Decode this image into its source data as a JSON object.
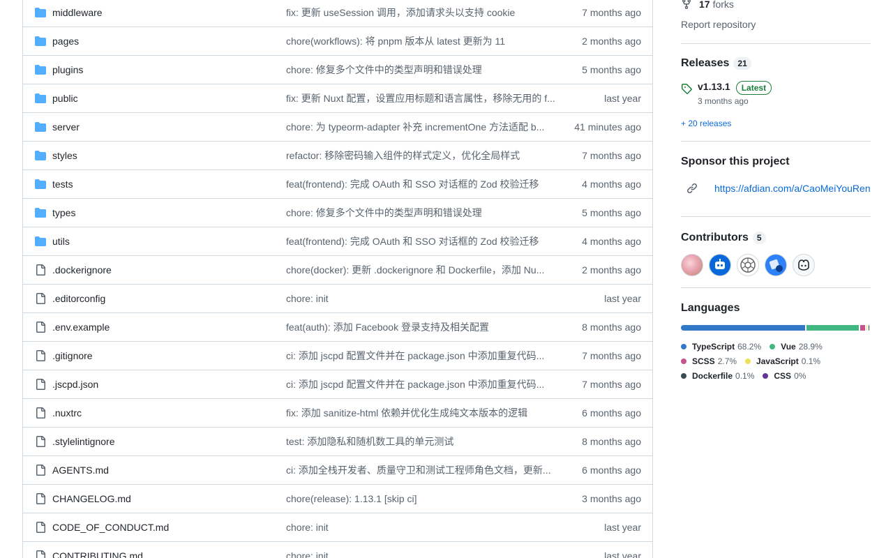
{
  "files": [
    {
      "type": "dir",
      "name": "middleware",
      "message": "fix: 更新 useSession 调用，添加请求头以支持 cookie",
      "date": "7 months ago"
    },
    {
      "type": "dir",
      "name": "pages",
      "message": "chore(workflows): 将 pnpm 版本从 latest 更新为 11",
      "date": "2 months ago"
    },
    {
      "type": "dir",
      "name": "plugins",
      "message": "chore: 修复多个文件中的类型声明和错误处理",
      "date": "5 months ago"
    },
    {
      "type": "dir",
      "name": "public",
      "message": "fix: 更新 Nuxt 配置，设置应用标题和语言属性，移除无用的 f...",
      "date": "last year"
    },
    {
      "type": "dir",
      "name": "server",
      "message": "chore: 为 typeorm-adapter 补充 incrementOne 方法适配 b...",
      "date": "41 minutes ago"
    },
    {
      "type": "dir",
      "name": "styles",
      "message": "refactor: 移除密码输入组件的样式定义，优化全局样式",
      "date": "7 months ago"
    },
    {
      "type": "dir",
      "name": "tests",
      "message": "feat(frontend): 完成 OAuth 和 SSO 对话框的 Zod 校验迁移",
      "date": "4 months ago"
    },
    {
      "type": "dir",
      "name": "types",
      "message": "chore: 修复多个文件中的类型声明和错误处理",
      "date": "5 months ago"
    },
    {
      "type": "dir",
      "name": "utils",
      "message": "feat(frontend): 完成 OAuth 和 SSO 对话框的 Zod 校验迁移",
      "date": "4 months ago"
    },
    {
      "type": "file",
      "name": ".dockerignore",
      "message": "chore(docker): 更新 .dockerignore 和 Dockerfile，添加 Nu...",
      "date": "2 months ago"
    },
    {
      "type": "file",
      "name": ".editorconfig",
      "message": "chore: init",
      "date": "last year"
    },
    {
      "type": "file",
      "name": ".env.example",
      "message": "feat(auth): 添加 Facebook 登录支持及相关配置",
      "date": "8 months ago"
    },
    {
      "type": "file",
      "name": ".gitignore",
      "message": "ci: 添加 jscpd 配置文件并在 package.json 中添加重复代码...",
      "date": "7 months ago"
    },
    {
      "type": "file",
      "name": ".jscpd.json",
      "message": "ci: 添加 jscpd 配置文件并在 package.json 中添加重复代码...",
      "date": "7 months ago"
    },
    {
      "type": "file",
      "name": ".nuxtrc",
      "message": "fix: 添加 sanitize-html 依赖并优化生成纯文本版本的逻辑",
      "date": "6 months ago"
    },
    {
      "type": "file",
      "name": ".stylelintignore",
      "message": "test: 添加隐私和随机数工具的单元测试",
      "date": "8 months ago"
    },
    {
      "type": "file",
      "name": "AGENTS.md",
      "message": "ci: 添加全栈开发者、质量守卫和测试工程师角色文档，更新...",
      "date": "6 months ago"
    },
    {
      "type": "file",
      "name": "CHANGELOG.md",
      "message": "chore(release): 1.13.1 [skip ci]",
      "date": "3 months ago"
    },
    {
      "type": "file",
      "name": "CODE_OF_CONDUCT.md",
      "message": "chore: init",
      "date": "last year"
    },
    {
      "type": "file",
      "name": "CONTRIBUTING.md",
      "message": "chore: init",
      "date": "last year"
    }
  ],
  "sidebar": {
    "forks_count": "17",
    "forks_label": "forks",
    "report_label": "Report repository",
    "releases": {
      "heading": "Releases",
      "count": "21",
      "tag": "v1.13.1",
      "latest_label": "Latest",
      "date": "3 months ago",
      "more_label": "+ 20 releases"
    },
    "sponsor": {
      "heading": "Sponsor this project",
      "url": "https://afdian.com/a/CaoMeiYouRen"
    },
    "contributors": {
      "heading": "Contributors",
      "count": "5",
      "avatar_colors": [
        "#f3c6c9",
        "#0969da",
        "#ffffff",
        "#2f81f7",
        "#f6f8fa"
      ]
    },
    "languages": {
      "heading": "Languages",
      "items": [
        {
          "name": "TypeScript",
          "pct": "68.2%",
          "value": 68.2,
          "color": "#3178c6"
        },
        {
          "name": "Vue",
          "pct": "28.9%",
          "value": 28.9,
          "color": "#41b883"
        },
        {
          "name": "SCSS",
          "pct": "2.7%",
          "value": 2.7,
          "color": "#c6538c"
        },
        {
          "name": "JavaScript",
          "pct": "0.1%",
          "value": 0.1,
          "color": "#f1e05a"
        },
        {
          "name": "Dockerfile",
          "pct": "0.1%",
          "value": 0.1,
          "color": "#384d54"
        },
        {
          "name": "CSS",
          "pct": "0%",
          "value": 0.0,
          "color": "#663399"
        }
      ]
    }
  }
}
